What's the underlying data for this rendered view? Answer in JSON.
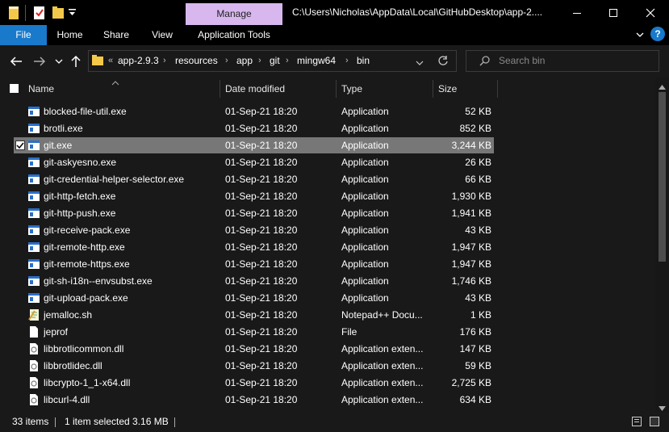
{
  "window": {
    "title": "C:\\Users\\Nicholas\\AppData\\Local\\GitHubDesktop\\app-2....",
    "context_tab": "Manage"
  },
  "ribbon": {
    "tabs": [
      {
        "label": "File"
      },
      {
        "label": "Home"
      },
      {
        "label": "Share"
      },
      {
        "label": "View"
      },
      {
        "label": "Application Tools"
      }
    ]
  },
  "address": {
    "prefix": "«",
    "crumbs": [
      "app-2.9.3",
      "resources",
      "app",
      "git",
      "mingw64",
      "bin"
    ]
  },
  "search": {
    "placeholder": "Search bin"
  },
  "columns": {
    "name": "Name",
    "date": "Date modified",
    "type": "Type",
    "size": "Size"
  },
  "files": [
    {
      "name": "blocked-file-util.exe",
      "date": "01-Sep-21 18:20",
      "type": "Application",
      "size": "52 KB",
      "icon": "exe-icon"
    },
    {
      "name": "brotli.exe",
      "date": "01-Sep-21 18:20",
      "type": "Application",
      "size": "852 KB",
      "icon": "exe-icon"
    },
    {
      "name": "git.exe",
      "date": "01-Sep-21 18:20",
      "type": "Application",
      "size": "3,244 KB",
      "icon": "exe-icon",
      "selected": true
    },
    {
      "name": "git-askyesno.exe",
      "date": "01-Sep-21 18:20",
      "type": "Application",
      "size": "26 KB",
      "icon": "exe-icon"
    },
    {
      "name": "git-credential-helper-selector.exe",
      "date": "01-Sep-21 18:20",
      "type": "Application",
      "size": "66 KB",
      "icon": "exe-icon"
    },
    {
      "name": "git-http-fetch.exe",
      "date": "01-Sep-21 18:20",
      "type": "Application",
      "size": "1,930 KB",
      "icon": "exe-icon"
    },
    {
      "name": "git-http-push.exe",
      "date": "01-Sep-21 18:20",
      "type": "Application",
      "size": "1,941 KB",
      "icon": "exe-icon"
    },
    {
      "name": "git-receive-pack.exe",
      "date": "01-Sep-21 18:20",
      "type": "Application",
      "size": "43 KB",
      "icon": "exe-icon"
    },
    {
      "name": "git-remote-http.exe",
      "date": "01-Sep-21 18:20",
      "type": "Application",
      "size": "1,947 KB",
      "icon": "exe-icon"
    },
    {
      "name": "git-remote-https.exe",
      "date": "01-Sep-21 18:20",
      "type": "Application",
      "size": "1,947 KB",
      "icon": "exe-icon"
    },
    {
      "name": "git-sh-i18n--envsubst.exe",
      "date": "01-Sep-21 18:20",
      "type": "Application",
      "size": "1,746 KB",
      "icon": "exe-icon"
    },
    {
      "name": "git-upload-pack.exe",
      "date": "01-Sep-21 18:20",
      "type": "Application",
      "size": "43 KB",
      "icon": "exe-icon"
    },
    {
      "name": "jemalloc.sh",
      "date": "01-Sep-21 18:20",
      "type": "Notepad++ Docu...",
      "size": "1 KB",
      "icon": "notepad-file-icon"
    },
    {
      "name": "jeprof",
      "date": "01-Sep-21 18:20",
      "type": "File",
      "size": "176 KB",
      "icon": "blank-file-icon"
    },
    {
      "name": "libbrotlicommon.dll",
      "date": "01-Sep-21 18:20",
      "type": "Application exten...",
      "size": "147 KB",
      "icon": "dll-icon"
    },
    {
      "name": "libbrotlidec.dll",
      "date": "01-Sep-21 18:20",
      "type": "Application exten...",
      "size": "59 KB",
      "icon": "dll-icon"
    },
    {
      "name": "libcrypto-1_1-x64.dll",
      "date": "01-Sep-21 18:20",
      "type": "Application exten...",
      "size": "2,725 KB",
      "icon": "dll-icon"
    },
    {
      "name": "libcurl-4.dll",
      "date": "01-Sep-21 18:20",
      "type": "Application exten...",
      "size": "634 KB",
      "icon": "dll-icon"
    }
  ],
  "status": {
    "count": "33 items",
    "selection": "1 item selected  3.16 MB"
  },
  "colors": {
    "accent": "#1979ca",
    "manage": "#d7b7ee",
    "selected_row": "#777777",
    "background": "#191919"
  }
}
